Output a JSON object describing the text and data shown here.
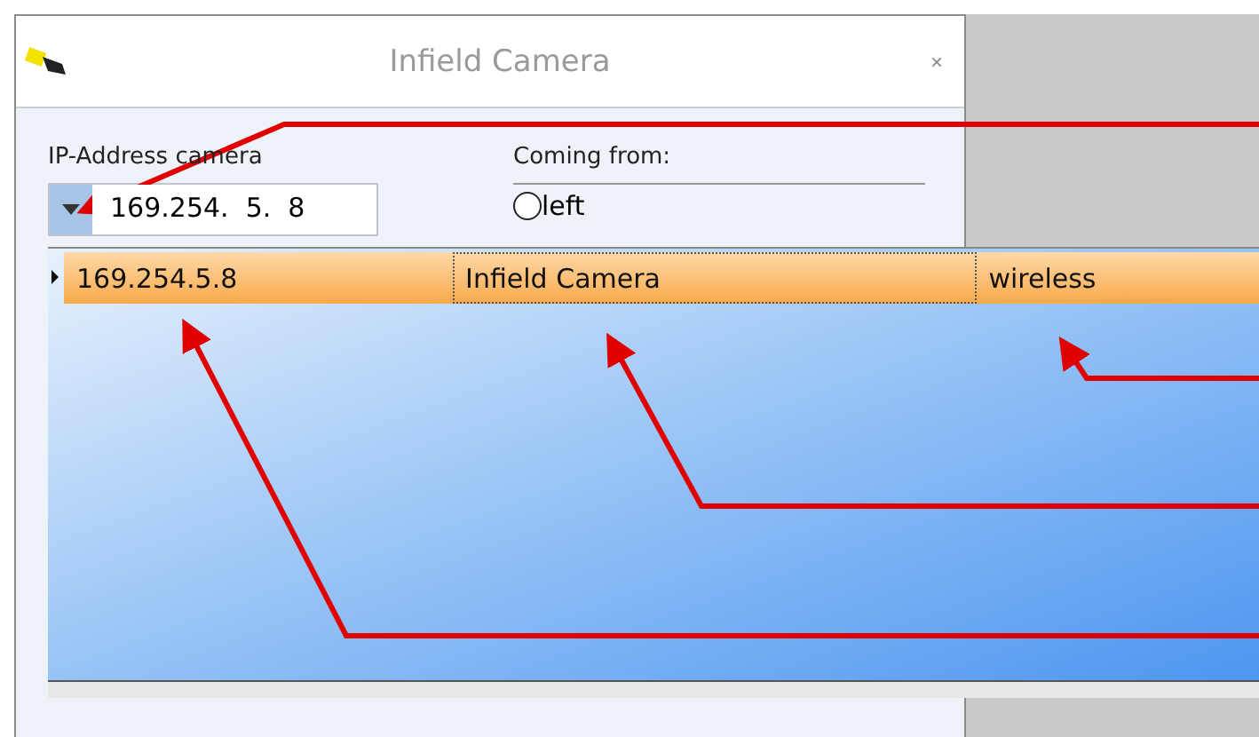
{
  "window": {
    "title": "Infield Camera",
    "close": "×"
  },
  "ip_address": {
    "label": "IP-Address camera",
    "value": "169.254.  5.  8",
    "expanded": true
  },
  "coming_from": {
    "label": "Coming from:",
    "options": [
      {
        "label": "left",
        "selected": false
      }
    ]
  },
  "dropdown_rows": [
    {
      "selected": true,
      "cells": [
        {
          "text": "169.254.5.8",
          "focused": false
        },
        {
          "text": "Infield Camera",
          "focused": true
        },
        {
          "text": "wireless",
          "focused": false
        }
      ]
    }
  ]
}
